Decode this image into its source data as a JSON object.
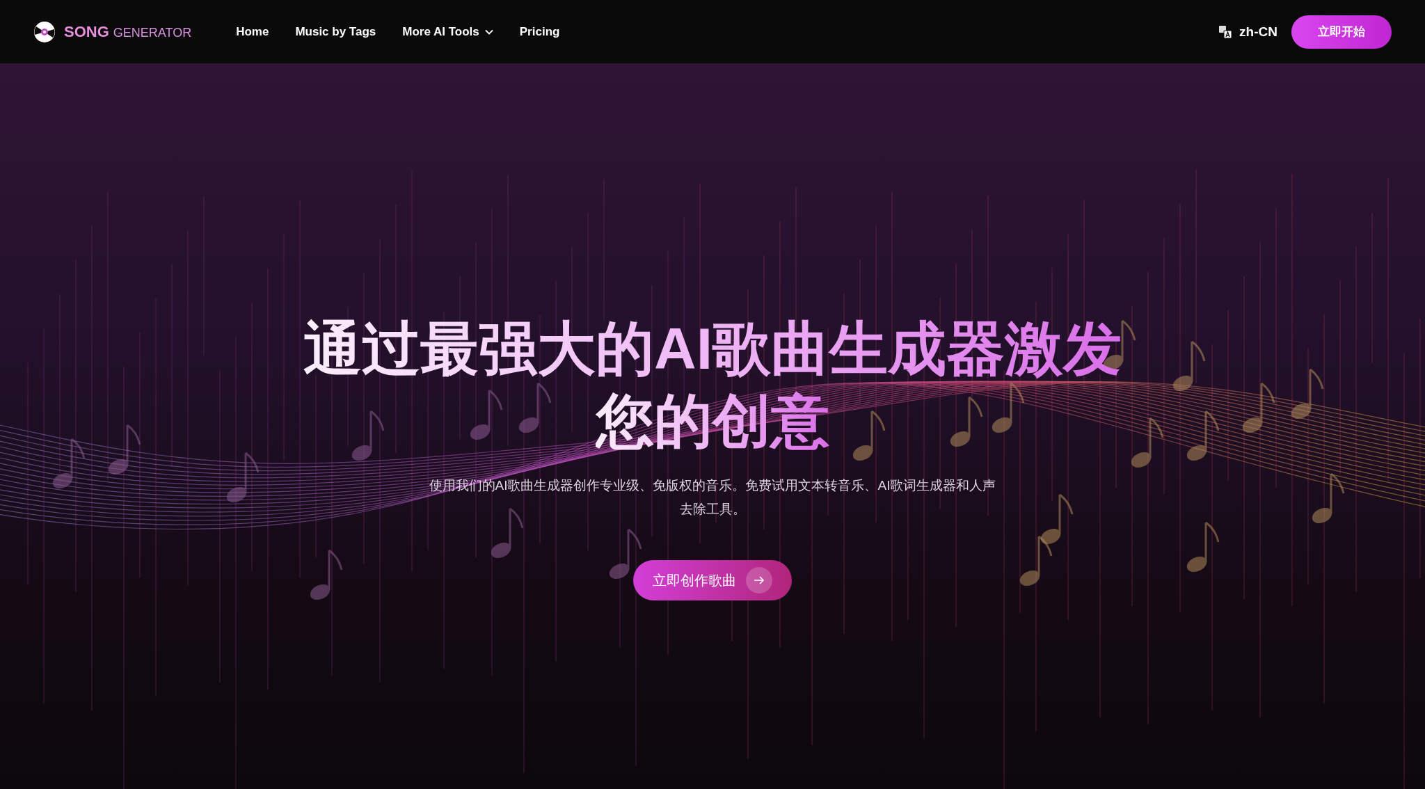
{
  "header": {
    "logo": {
      "bold": "SONG",
      "light": "GENERATOR"
    },
    "nav": [
      {
        "label": "Home",
        "kind": "link"
      },
      {
        "label": "Music by Tags",
        "kind": "link"
      },
      {
        "label": "More AI Tools",
        "kind": "dropdown"
      },
      {
        "label": "Pricing",
        "kind": "link"
      }
    ],
    "language": "zh-CN",
    "cta": "立即开始"
  },
  "hero": {
    "title_lines": [
      "通过最强大的AI歌曲生成器激发",
      "您的创意"
    ],
    "subtitle": "使用我们的AI歌曲生成器创作专业级、免版权的音乐。免费试用文本转音乐、AI歌词生成器和人声去除工具。",
    "button": "立即创作歌曲"
  }
}
